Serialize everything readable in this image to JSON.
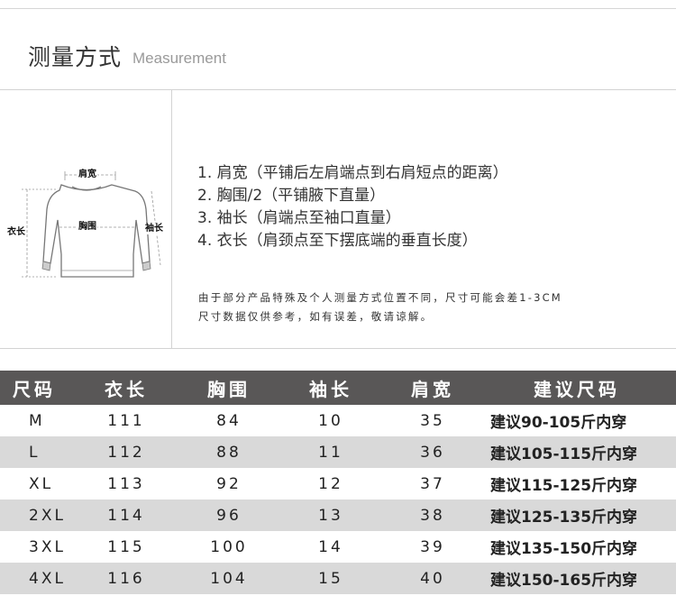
{
  "header": {
    "title_cn": "测量方式",
    "title_en": "Measurement"
  },
  "diagram": {
    "label_shoulder": "肩宽",
    "label_chest": "胸围",
    "label_length": "衣长",
    "label_sleeve": "袖长"
  },
  "steps": [
    "1. 肩宽（平铺后左肩端点到右肩短点的距离）",
    "2. 胸围/2（平铺腋下直量）",
    "3. 袖长（肩端点至袖口直量）",
    "4. 衣长（肩颈点至下摆底端的垂直长度）"
  ],
  "note": {
    "line1": "由于部分产品特殊及个人测量方式位置不同，尺寸可能会差1-3CM",
    "line2": "尺寸数据仅供参考，如有误差，敬请谅解。"
  },
  "table": {
    "headers": [
      "尺码",
      "衣长",
      "胸围",
      "袖长",
      "肩宽",
      "建议尺码"
    ],
    "rows": [
      [
        "M",
        "111",
        "84",
        "10",
        "35",
        "建议90-105斤内穿"
      ],
      [
        "L",
        "112",
        "88",
        "11",
        "36",
        "建议105-115斤内穿"
      ],
      [
        "XL",
        "113",
        "92",
        "12",
        "37",
        "建议115-125斤内穿"
      ],
      [
        "2XL",
        "114",
        "96",
        "13",
        "38",
        "建议125-135斤内穿"
      ],
      [
        "3XL",
        "115",
        "100",
        "14",
        "39",
        "建议135-150斤内穿"
      ],
      [
        "4XL",
        "116",
        "104",
        "15",
        "40",
        "建议150-165斤内穿"
      ]
    ]
  },
  "colors": {
    "header_bg": "#595757",
    "alt_row": "#d9d9d9",
    "recommend_text": "#e0101c"
  }
}
